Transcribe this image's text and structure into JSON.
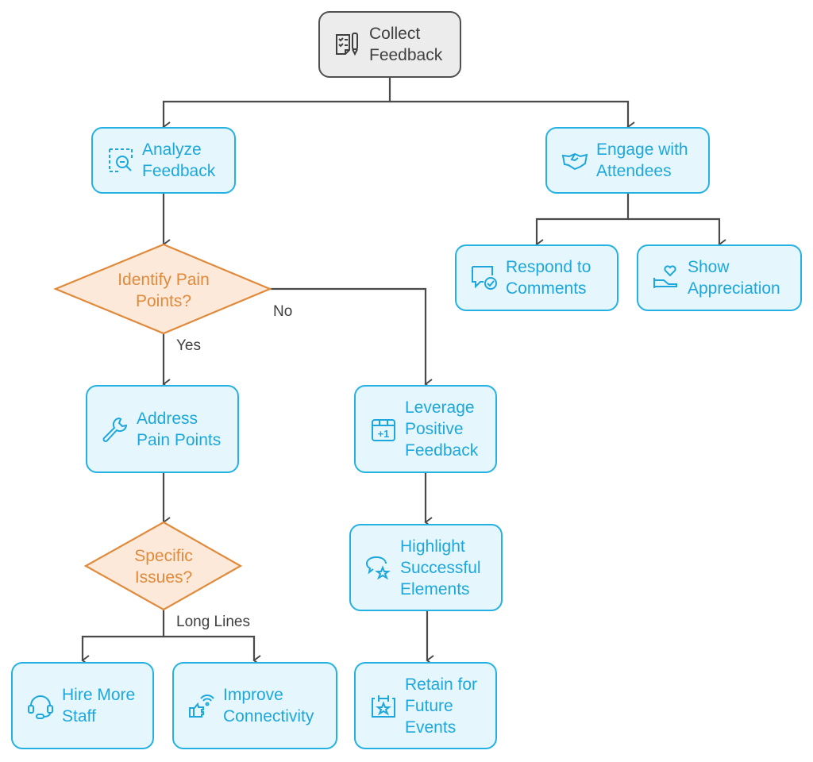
{
  "diagram": {
    "colors": {
      "process_fill": "#e5f7fd",
      "process_border": "#25b2e2",
      "process_text": "#1ea7dc",
      "root_fill": "#ececec",
      "root_border": "#505050",
      "decision_fill": "#fde9d9",
      "decision_border": "#e08a3c",
      "decision_text": "#e08a3c",
      "edge_color": "#4a4a4a"
    },
    "nodes": {
      "collect": {
        "label": "Collect\nFeedback",
        "icon": "checklist-pen-icon"
      },
      "analyze": {
        "label": "Analyze\nFeedback",
        "icon": "zoom-out-selection-icon"
      },
      "engage": {
        "label": "Engage with\nAttendees",
        "icon": "handshake-icon"
      },
      "respond": {
        "label": "Respond to\nComments",
        "icon": "comment-check-icon"
      },
      "appreciation": {
        "label": "Show\nAppreciation",
        "icon": "hand-heart-icon"
      },
      "identify": {
        "label": "Identify Pain\nPoints?"
      },
      "address": {
        "label": "Address\nPain Points",
        "icon": "wrench-icon"
      },
      "leverage": {
        "label": "Leverage\nPositive\nFeedback",
        "icon": "calendar-plus-one-icon"
      },
      "specific": {
        "label": "Specific\nIssues?"
      },
      "highlight": {
        "label": "Highlight\nSuccessful\nElements",
        "icon": "comment-star-icon"
      },
      "hire": {
        "label": "Hire More\nStaff",
        "icon": "headset-icon"
      },
      "connectivity": {
        "label": "Improve\nConnectivity",
        "icon": "thumbs-up-wifi-icon"
      },
      "retain": {
        "label": "Retain for\nFuture\nEvents",
        "icon": "calendar-star-icon"
      }
    },
    "edge_labels": {
      "no": "No",
      "yes": "Yes",
      "long_lines": "Long Lines"
    }
  }
}
